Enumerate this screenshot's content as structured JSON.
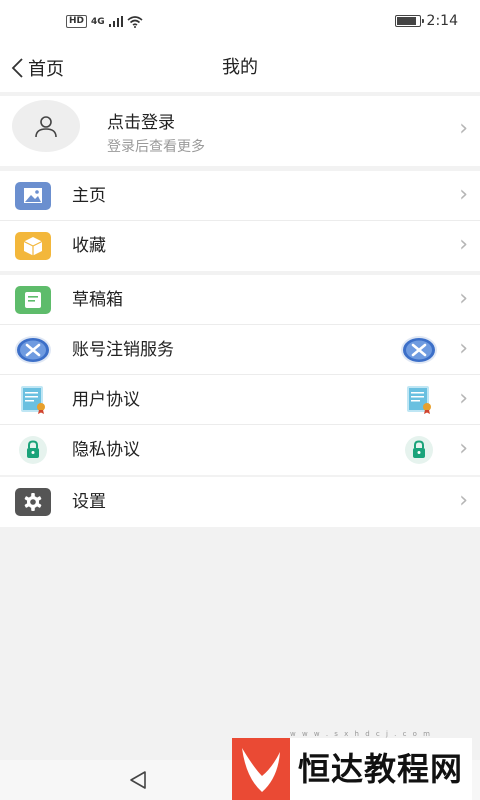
{
  "status_bar": {
    "hd": "HD",
    "network": "4G",
    "time": "2:14",
    "battery_level": 0.9
  },
  "header": {
    "back_label": "首页",
    "title": "我的"
  },
  "profile": {
    "title": "点击登录",
    "subtitle": "登录后查看更多"
  },
  "menu": {
    "group1": [
      {
        "label": "主页",
        "icon": "image-icon",
        "color": "#6b8fcf"
      },
      {
        "label": "收藏",
        "icon": "box-icon",
        "color": "#f3b73b"
      }
    ],
    "group2": [
      {
        "label": "草稿箱",
        "icon": "draft-icon",
        "color": "#5ebc6b"
      },
      {
        "label": "账号注销服务",
        "icon": "cancel-account-icon",
        "color": "#3c6fc8"
      },
      {
        "label": "用户协议",
        "icon": "certificate-icon",
        "color": "#6ac0e0"
      },
      {
        "label": "隐私协议",
        "icon": "lock-icon",
        "color": "#1aa37a"
      }
    ],
    "group3": [
      {
        "label": "设置",
        "icon": "gear-icon",
        "color": "#555555"
      }
    ]
  },
  "watermark": {
    "text": "恒达教程网",
    "url": "w w w . s x h d c j . c o m"
  }
}
